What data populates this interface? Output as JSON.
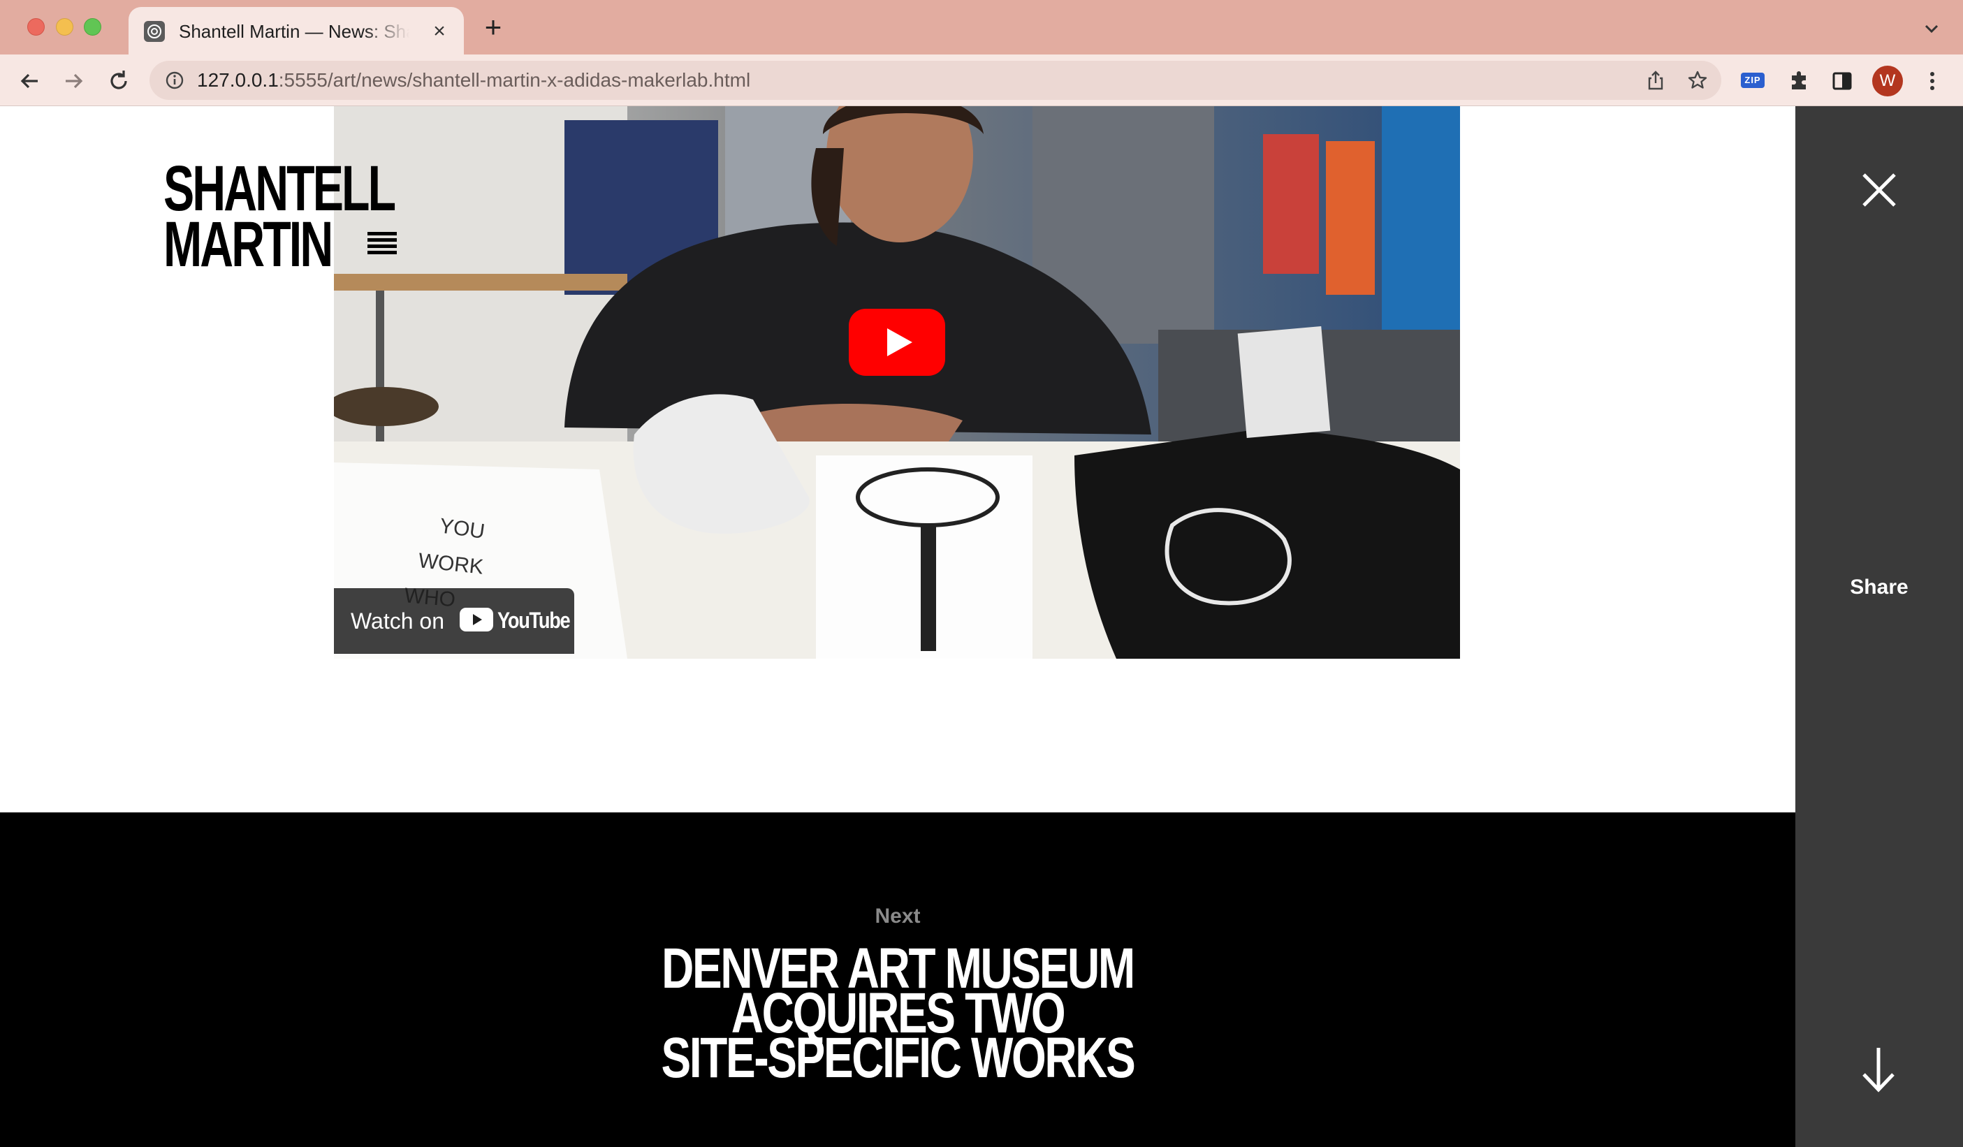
{
  "browser": {
    "tab_title": "Shantell Martin — News: Shantell Martin x adidas MakerLab",
    "url_host": "127.0.0.1",
    "url_rest": ":5555/art/news/shantell-martin-x-adidas-makerlab.html",
    "extension_badge": "ZIP",
    "profile_initial": "W",
    "icons": [
      "back-icon",
      "forward-icon",
      "reload-icon",
      "info-icon",
      "share-icon",
      "star-icon",
      "puzzle-icon",
      "side-panel-icon",
      "kebab-menu-icon",
      "tab-dropdown-icon"
    ]
  },
  "site": {
    "logo_line1": "SHANTELL",
    "logo_line2": "MARTIN",
    "video": {
      "watch_on_label": "Watch on",
      "youtube_word": "YouTube"
    },
    "sidebar": {
      "share_label": "Share"
    },
    "next": {
      "label": "Next",
      "title_line1": "DENVER ART MUSEUM ACQUIRES TWO",
      "title_line2": "SITE-SPECIFIC WORKS"
    }
  },
  "colors": {
    "tabbar": "#e2aca0",
    "toolbar": "#f7e7e3",
    "sidebar": "#3a3a3a",
    "next_band": "#000000",
    "youtube_red": "#ff0000"
  }
}
